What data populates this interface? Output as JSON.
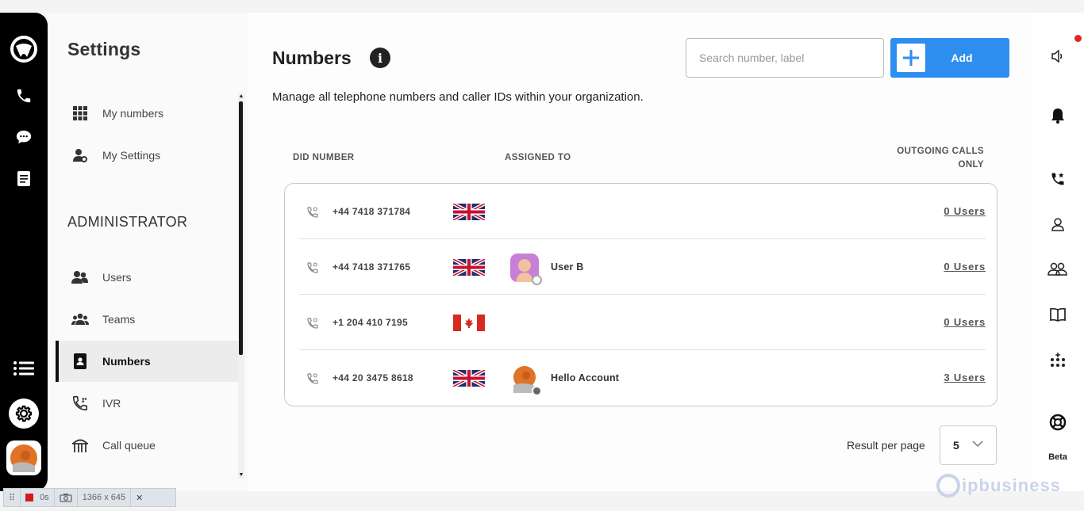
{
  "settings": {
    "title": "Settings",
    "items": [
      {
        "label": "My numbers"
      },
      {
        "label": "My Settings"
      }
    ],
    "admin_heading": "ADMINISTRATOR",
    "admin_items": [
      {
        "label": "Users"
      },
      {
        "label": "Teams"
      },
      {
        "label": "Numbers",
        "active": true
      },
      {
        "label": "IVR"
      },
      {
        "label": "Call queue"
      }
    ]
  },
  "main": {
    "title": "Numbers",
    "subtitle": "Manage all telephone numbers and caller IDs within your organization.",
    "search_placeholder": "Search number, label",
    "add_label": "Add",
    "columns": {
      "did": "DID NUMBER",
      "assigned": "ASSIGNED TO",
      "outgoing_line1": "OUTGOING CALLS",
      "outgoing_line2": "ONLY"
    },
    "rows": [
      {
        "number": "+44 7418 371784",
        "flag": "uk",
        "assigned": "",
        "users": "0 Users"
      },
      {
        "number": "+44 7418 371765",
        "flag": "uk",
        "assigned": "User B",
        "users": "0 Users"
      },
      {
        "number": "+1 204 410 7195",
        "flag": "canada",
        "assigned": "",
        "users": "0 Users"
      },
      {
        "number": "+44 20 3475 8618",
        "flag": "uk",
        "assigned": "Hello Account",
        "users": "3 Users"
      }
    ],
    "result_per_page_label": "Result per page",
    "result_per_page_value": "5"
  },
  "right_rail": {
    "beta_label": "Beta"
  },
  "brand": {
    "text": "ipbusiness"
  },
  "recorder": {
    "time": "0s",
    "size": "1366 x 645"
  },
  "colors": {
    "accent": "#2e8ef0",
    "rail": "#000000",
    "notification": "#e0262b"
  }
}
